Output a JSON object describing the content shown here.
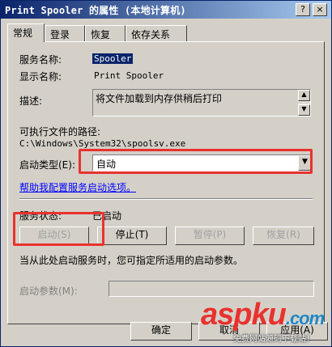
{
  "window": {
    "title": "Print Spooler 的属性 (本地计算机)",
    "help_glyph": "?",
    "close_glyph": "×"
  },
  "tabs": [
    {
      "label": "常规"
    },
    {
      "label": "登录"
    },
    {
      "label": "恢复"
    },
    {
      "label": "依存关系"
    }
  ],
  "general": {
    "service_name_label": "服务名称:",
    "service_name_value": "Spooler",
    "display_name_label": "显示名称:",
    "display_name_value": "Print Spooler",
    "description_label": "描述:",
    "description_value": "将文件加载到内存供稍后打印",
    "path_label": "可执行文件的路径:",
    "path_value": "C:\\Windows\\System32\\spoolsv.exe",
    "startup_type_label": "启动类型(E):",
    "startup_type_value": "自动",
    "help_link": "帮助我配置服务启动选项。",
    "status_label": "服务状态:",
    "status_value": "已启动",
    "start_button": "启动(S)",
    "stop_button": "停止(T)",
    "pause_button": "暂停(P)",
    "resume_button": "恢复(R)",
    "hint_text": "当从此处启动服务时，您可指定所适用的启动参数。",
    "params_label": "启动参数(M):",
    "params_value": ""
  },
  "footer": {
    "ok_button": "确定",
    "cancel_button": "取消",
    "apply_button": "应用(A)"
  },
  "watermark": {
    "brand": "aspku",
    "domain": ".com",
    "tagline": "免费网站源码下载站！"
  },
  "colors": {
    "highlight_box": "#e8322e",
    "title_bar": "#0a246a",
    "link": "#0000ff",
    "watermark_a": "#e8322e",
    "watermark_b": "#1e88c8"
  }
}
